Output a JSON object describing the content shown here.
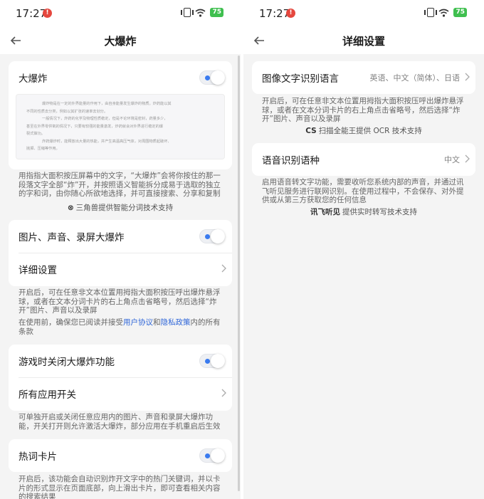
{
  "colors": {
    "accent": "#3a7bf0",
    "link": "#2f66d8",
    "badge": "#e5473e",
    "battery": "#3fbf4f"
  },
  "statusbar": {
    "time": "17:27",
    "notif_badge": "!",
    "battery_level": "75"
  },
  "left": {
    "title": "大爆炸",
    "bigbang": {
      "label": "大爆炸",
      "toggle_on": true,
      "preview_lines": [
        "爆炸物是在一定的外界能量的作用下，由自身能量发生爆炸的物质。炸药能以其",
        "不同的性质去分类，例如以其扩张的速率去划分。",
        "一般情况下，炸药的化学及物理性质稳定，但是不论环境是密封，药量多少，",
        "甚至在外界零供氧的情况下，只要有较强的能量激发，炸药就会对外界进行稳定的爆",
        "裂式做功。",
        "炸药爆炸时，能释放出大量的热能，并产生高温高压气体，对周围物质起破坏、",
        "抛掷、压缩等作用。"
      ],
      "desc": "用指指大面积按压屏幕中的文字，“大爆炸”会将你按住的那一段落文字全部“炸”开，并按照语义智能拆分成易于选取的独立的字和词，由你随心所欲地选择，并可直接搜索、分享和复制",
      "credit_logo": "⊗",
      "credit_text": "三角兽提供智能分词技术支持"
    },
    "media": {
      "label": "图片、声音、录屏大爆炸",
      "toggle_on": true,
      "detail_label": "详细设置",
      "desc1": "开启后，可在任意非文本位置用拇指大面积按压呼出爆炸悬浮球，或者在文本分词卡片的右上角点击省略号，然后选择“炸开”图片、声音以及录屏",
      "desc2_prefix": "在使用前，确保您已阅读并接受",
      "link_agreement": "用户协议",
      "desc2_and": "和",
      "link_privacy": "隐私政策",
      "desc2_suffix": "内的所有条款"
    },
    "game": {
      "label": "游戏时关闭大爆炸功能",
      "toggle_on": true,
      "all_apps_label": "所有应用开关",
      "desc": "可单独开启或关闭任意应用内的图片、声音和录屏大爆炸功能，开关打开则允许激活大爆炸，部分应用在手机重启后生效"
    },
    "hotword": {
      "label": "热词卡片",
      "toggle_on": true,
      "desc": "开启后，该功能会自动识别炸开文字中的热门关键词，并以卡片的形式显示在页面底部，向上滑出卡片，即可查看相关内容的搜索结果"
    }
  },
  "right": {
    "title": "详细设置",
    "ocr": {
      "label": "图像文字识别语言",
      "value": "英语、中文（简体）、日语",
      "desc": "开启后，可在任意非文本位置用拇指大面积按压呼出爆炸悬浮球，或者在文本分词卡片的右上角点击省略号，然后选择“炸开”图片、声音以及录屏",
      "credit_logo": "CS",
      "credit_text": "扫描全能王提供 OCR 技术支持"
    },
    "speech": {
      "label": "语音识别语种",
      "value": "中文",
      "desc": "启用语音转文字功能，需要收听您系统内部的声音，并通过讯飞听见服务进行联网识别。在使用过程中，不会保存、对外提供或从第三方获取您的任何信息",
      "credit_logo": "讯飞听见",
      "credit_text": "提供实时转写技术支持"
    }
  }
}
